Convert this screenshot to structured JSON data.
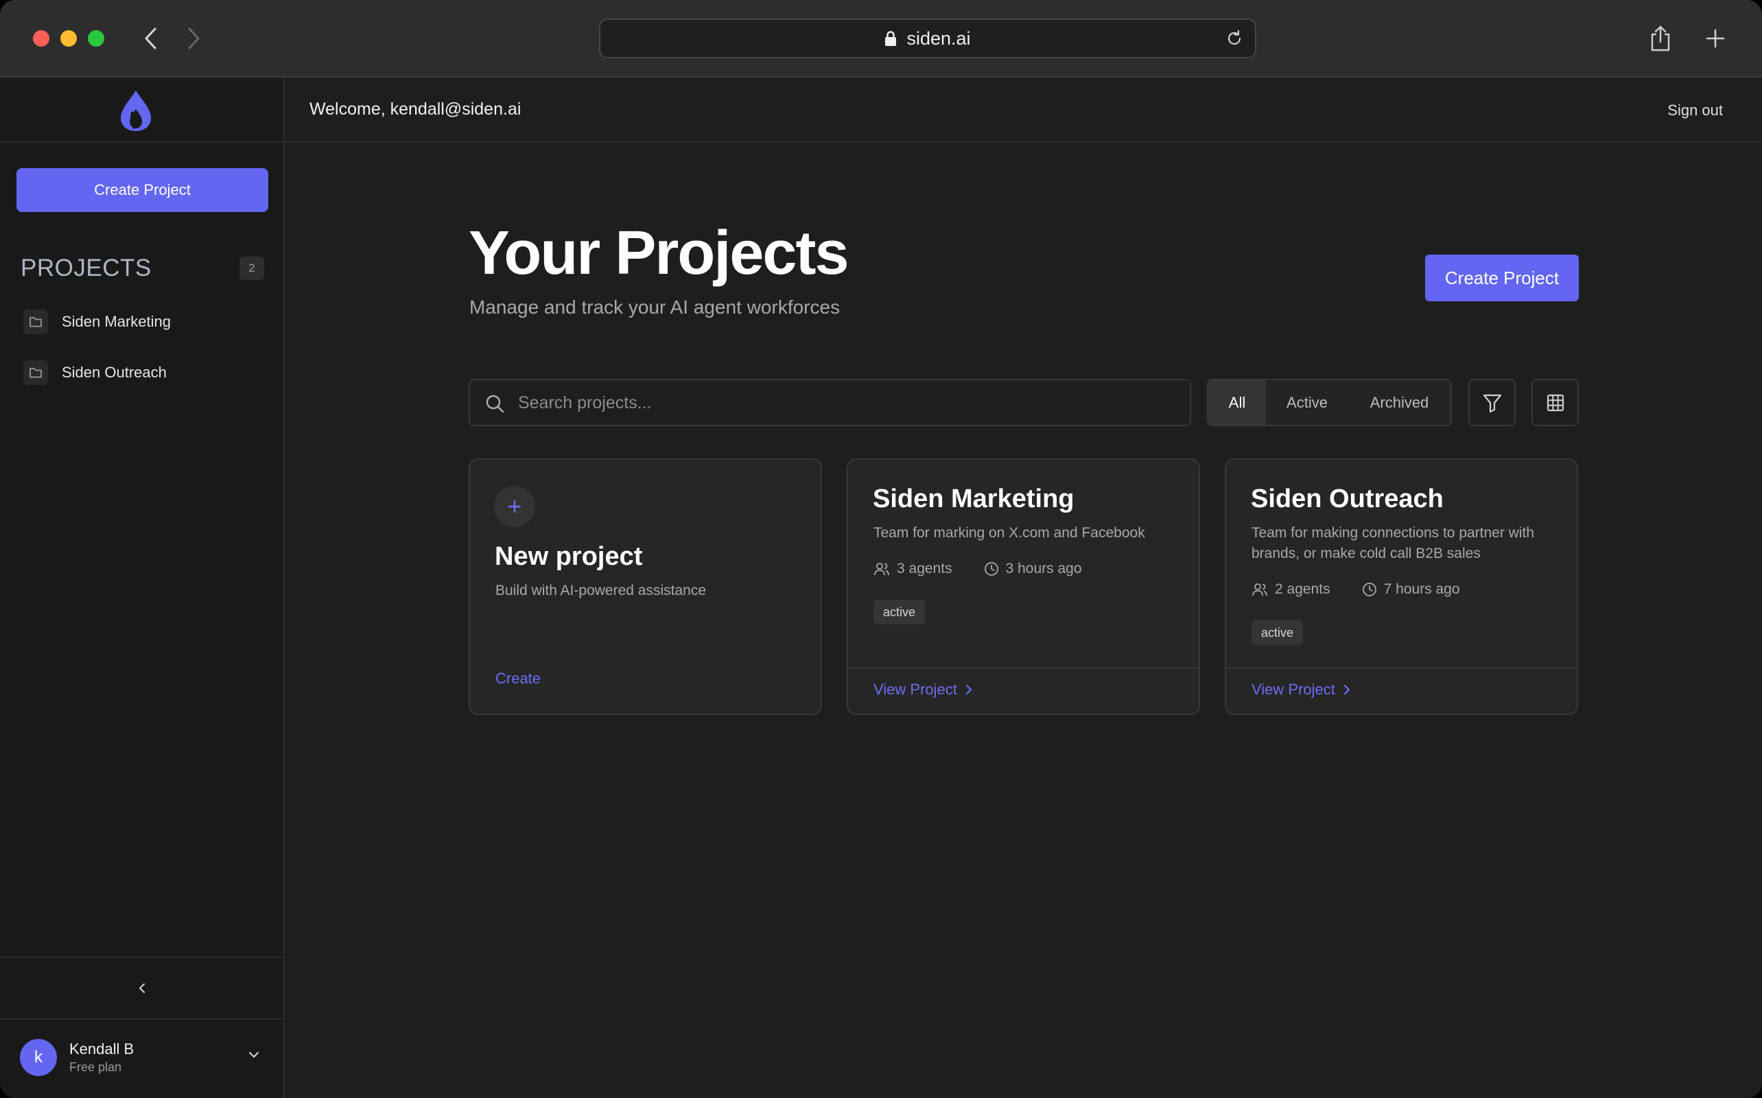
{
  "browser": {
    "url": "siden.ai"
  },
  "sidebar": {
    "create_label": "Create Project",
    "projects_heading": "PROJECTS",
    "projects_count": "2",
    "items": [
      {
        "label": "Siden Marketing"
      },
      {
        "label": "Siden Outreach"
      }
    ],
    "user": {
      "initial": "k",
      "name": "Kendall B",
      "plan": "Free plan"
    }
  },
  "header": {
    "welcome": "Welcome, kendall@siden.ai",
    "signout": "Sign out"
  },
  "main": {
    "title": "Your Projects",
    "subtitle": "Manage and track your AI agent workforces",
    "create_label": "Create Project",
    "search": {
      "placeholder": "Search projects...",
      "value": ""
    },
    "filters": {
      "all": "All",
      "active": "Active",
      "archived": "Archived",
      "selected": "All"
    },
    "new_card": {
      "plus": "+",
      "title": "New project",
      "subtitle": "Build with AI-powered assistance",
      "link": "Create"
    },
    "cards": [
      {
        "title": "Siden Marketing",
        "description": "Team for marking on X.com and Facebook",
        "agents": "3 agents",
        "updated": "3 hours ago",
        "status": "active",
        "link": "View Project"
      },
      {
        "title": "Siden Outreach",
        "description": "Team for making connections to partner with brands, or make cold call B2B sales",
        "agents": "2 agents",
        "updated": "7 hours ago",
        "status": "active",
        "link": "View Project"
      }
    ]
  },
  "colors": {
    "accent": "#6366f1",
    "background": "#1e1e1e",
    "sidebar": "#191919",
    "card": "#262626"
  }
}
